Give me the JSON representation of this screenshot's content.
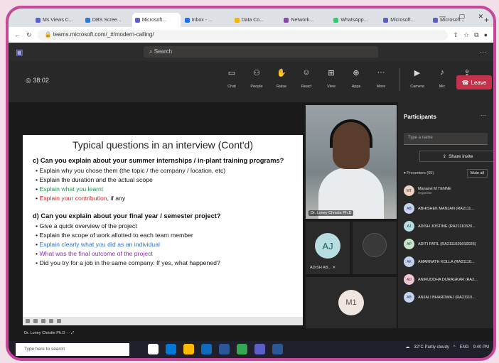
{
  "browser": {
    "tabs": [
      {
        "label": "Ms Views C...",
        "color": "#5b5fc7",
        "active": false
      },
      {
        "label": "DBS Scree...",
        "color": "#2b79d0",
        "active": false
      },
      {
        "label": "Microsoft...",
        "color": "#5b5fc7",
        "active": true
      },
      {
        "label": "Inbox - ...",
        "color": "#1a73e8",
        "active": false
      },
      {
        "label": "Data Co...",
        "color": "#f4b400",
        "active": false
      },
      {
        "label": "Network...",
        "color": "#8e44ad",
        "active": false
      },
      {
        "label": "WhatsApp...",
        "color": "#25d366",
        "active": false
      },
      {
        "label": "Microsoft...",
        "color": "#5b5fc7",
        "active": false
      },
      {
        "label": "Microsoft...",
        "color": "#5b5fc7",
        "active": false
      }
    ],
    "url": "teams.microsoft.com/_#/modern-calling/"
  },
  "teams": {
    "search_placeholder": "Search"
  },
  "meeting": {
    "timer": "38:02",
    "tools": [
      {
        "icon": "chat-icon",
        "glyph": "▭",
        "label": "Chat"
      },
      {
        "icon": "people-icon",
        "glyph": "⚇",
        "label": "People"
      },
      {
        "icon": "raise-hand-icon",
        "glyph": "✋",
        "label": "Raise"
      },
      {
        "icon": "react-icon",
        "glyph": "☺",
        "label": "React"
      },
      {
        "icon": "view-icon",
        "glyph": "⊞",
        "label": "View"
      },
      {
        "icon": "apps-icon",
        "glyph": "⊕",
        "label": "Apps"
      },
      {
        "icon": "more-icon",
        "glyph": "···",
        "label": "More"
      }
    ],
    "media_tools": [
      {
        "icon": "camera-icon",
        "glyph": "▶",
        "label": "Camera"
      },
      {
        "icon": "mic-icon",
        "glyph": "♪",
        "label": "Mic"
      },
      {
        "icon": "share-icon",
        "glyph": "⇪",
        "label": "Share"
      }
    ],
    "leave_label": "Leave"
  },
  "slide": {
    "title": "Typical questions in an interview (Cont'd)",
    "section1_question": "c) Can you explain about your summer internships / in-plant training programs?",
    "section1_items": [
      {
        "text": "Explain why you chose them (the topic / the company / location, etc)",
        "cls": ""
      },
      {
        "text": "Explain the duration and the actual scope",
        "cls": ""
      },
      {
        "text": "Explain what you learnt",
        "cls": "c-green"
      },
      {
        "text": "Explain your contribution",
        "suffix": ", if any",
        "cls": "c-red"
      }
    ],
    "section2_question": "d) Can you explain about your final year / semester project?",
    "section2_items": [
      {
        "text": "Give a quick overview of the project",
        "cls": ""
      },
      {
        "text": "Explain the scope of work allotted to each team member",
        "cls": ""
      },
      {
        "text": "Explain clearly what you did as an individual",
        "cls": "c-blue"
      },
      {
        "text": "What was the final outcome of the project",
        "cls": "c-purple"
      },
      {
        "text": "Did you try for a job in the same company. If yes, what happened?",
        "cls": ""
      }
    ]
  },
  "videos": {
    "main_caption": "Dr. Loney Christie Ph.D",
    "aj_initials": "AJ",
    "aj_caption": "ADISH AB...",
    "m1_initials": "M1"
  },
  "participants": {
    "title": "Participants",
    "type_name_placeholder": "Type a name",
    "share_invite": "Share invite",
    "presenters_label": "Presenters (65)",
    "mute_all": "Mute all",
    "list": [
      {
        "initials": "MT",
        "name": "Manasvi M TENNE",
        "sub": "Organiser",
        "color": "#f0d2c0"
      },
      {
        "initials": "AB",
        "name": "ABHISHEK MANJAN (RA2111...",
        "sub": "",
        "color": "#c3d3f2"
      },
      {
        "initials": "AJ",
        "name": "ADISH JOSTINE (RA21110320...",
        "sub": "",
        "color": "#b8dde0"
      },
      {
        "initials": "AP",
        "name": "ADITI PATIL (RA2111029010026)",
        "sub": "",
        "color": "#c7e6c8"
      },
      {
        "initials": "AK",
        "name": "AMARNATH KOLLA (RA21110...",
        "sub": "",
        "color": "#c3d3f2"
      },
      {
        "initials": "AD",
        "name": "ANIRUDDHA DURAGKAR (RA2...",
        "sub": "",
        "color": "#f2c6d8"
      },
      {
        "initials": "AB",
        "name": "ANJALI BHARDWAJ (RA21110...",
        "sub": "",
        "color": "#c3d3f2"
      }
    ]
  },
  "bottom": {
    "presenter_tag": "Dr. Loney Christie Ph.D"
  },
  "taskbar": {
    "search_placeholder": "Type here to search",
    "weather": "32°C  Partly cloudy",
    "lang": "ENG",
    "time": "9:40 PM"
  }
}
